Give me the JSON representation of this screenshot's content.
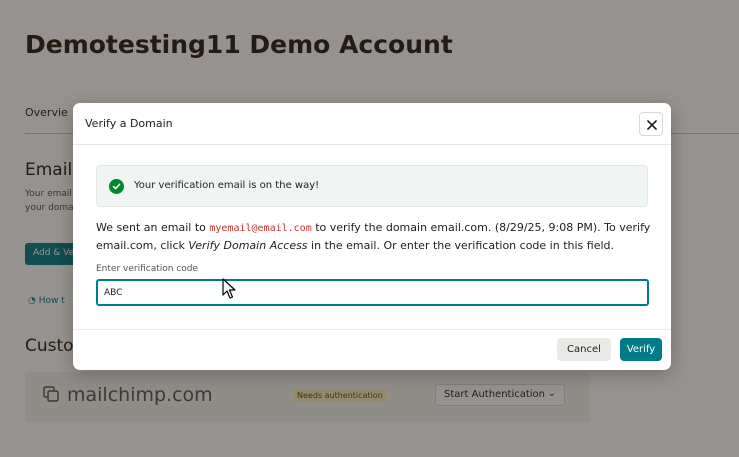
{
  "page": {
    "title": "Demotesting11 Demo Account",
    "tab_overview": "Overvie",
    "section_email_title": "Email d",
    "section_email_desc_1": "Your email",
    "section_email_desc_2": "your doma",
    "add_button_label": "Add & Ve",
    "howto_link": "How t",
    "section_custom_title": "Custo",
    "domain_card": {
      "icon": "copy-icon",
      "domain": "mailchimp.com",
      "badge": "Needs authentication",
      "action_select": "Start Authentication"
    }
  },
  "modal": {
    "title": "Verify a Domain",
    "close_icon": "close-icon",
    "alert": {
      "icon": "check-circle-icon",
      "text": "Your verification email is on the way!",
      "color": "#00892c"
    },
    "body": {
      "part1": "We sent an email to ",
      "email": "myemail@email.com",
      "part2": " to verify the domain email.com. (8/29/25, 9:08 PM). To verify email.com, click ",
      "link_text": "Verify Domain Access",
      "part3": " in the email. Or enter the verification code in this field."
    },
    "field_label": "Enter verification code",
    "field_value": "ABC",
    "cancel_label": "Cancel",
    "verify_label": "Verify"
  },
  "colors": {
    "accent": "#007c89",
    "badge_bg": "#fbeeb8"
  }
}
